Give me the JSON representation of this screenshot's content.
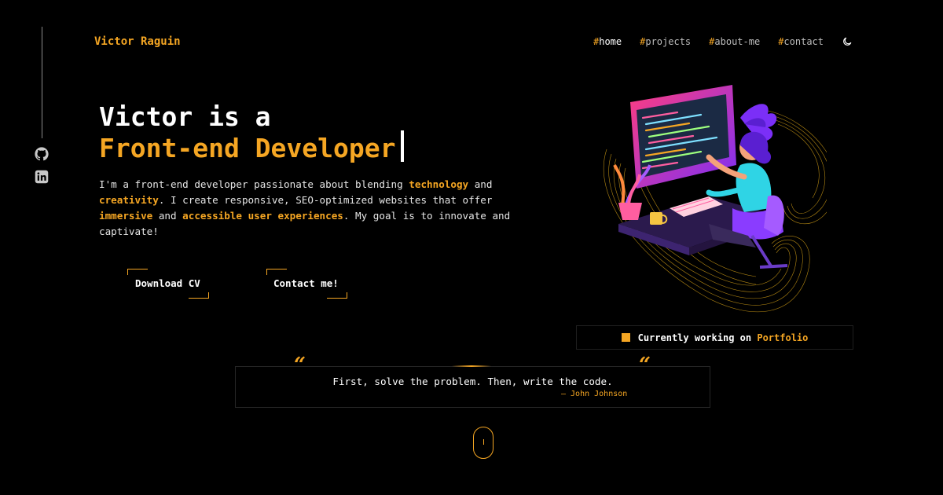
{
  "brand": {
    "name": "Victor Raguin",
    "accent_color": "#f5a623"
  },
  "social": [
    {
      "icon": "github-icon",
      "label": "GitHub"
    },
    {
      "icon": "linkedin-icon",
      "label": "LinkedIn"
    }
  ],
  "nav": {
    "items": [
      {
        "hash": "#",
        "label": "home",
        "active": true
      },
      {
        "hash": "#",
        "label": "projects",
        "active": false
      },
      {
        "hash": "#",
        "label": "about-me",
        "active": false
      },
      {
        "hash": "#",
        "label": "contact",
        "active": false
      }
    ],
    "theme_toggle_icon": "moon-icon"
  },
  "hero": {
    "title_line1": "Victor is a",
    "title_line2": "Front-end Developer",
    "description": {
      "p1": "I'm a front-end developer passionate about blending ",
      "hl1": "technology",
      "p2": " and ",
      "hl2": "creativity",
      "p3": ". I create responsive, SEO-optimized websites that offer ",
      "hl3": "immersive",
      "p4": " and ",
      "hl4": "accessible user experiences",
      "p5": ". My goal is to innovate and captivate!"
    },
    "buttons": {
      "download_cv": "Download CV",
      "contact": "Contact me!"
    }
  },
  "status": {
    "prefix": "Currently working on",
    "project": "Portfolio"
  },
  "quote": {
    "open_mark": "“",
    "close_mark": "“",
    "text": "First, solve the problem. Then, write the code.",
    "author": "— John Johnson"
  }
}
